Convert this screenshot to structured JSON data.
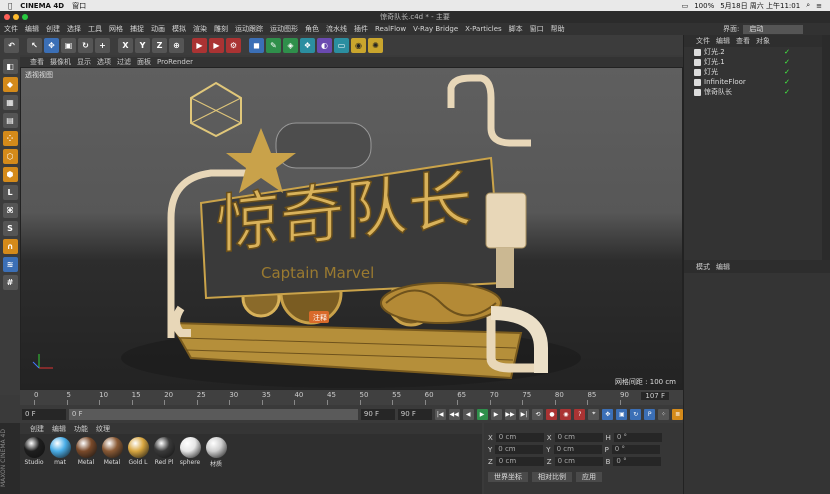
{
  "mac": {
    "app": "CINEMA 4D",
    "menu": "窗口",
    "battery": "100%",
    "datetime": "5月18日 周六 上午11:01"
  },
  "window": {
    "title": "惊奇队长.c4d * - 主要"
  },
  "menubar": [
    "文件",
    "编辑",
    "创建",
    "选择",
    "工具",
    "网格",
    "捕捉",
    "动画",
    "模拟",
    "渲染",
    "雕刻",
    "运动跟踪",
    "运动图形",
    "角色",
    "流水线",
    "插件",
    "RealFlow",
    "V-Ray Bridge",
    "X-Particles",
    "脚本",
    "窗口",
    "帮助"
  ],
  "layout": {
    "label": "界面:",
    "value": "启动"
  },
  "toolbar": {
    "axis_labels": [
      "X",
      "Y",
      "Z"
    ]
  },
  "viewport": {
    "menu": [
      "查看",
      "摄像机",
      "显示",
      "选项",
      "过滤",
      "面板",
      "ProRender"
    ],
    "label": "透视视图",
    "grid": "网格间距 : 100 cm",
    "annotation": "注释",
    "scene_text": "Captain Marvel"
  },
  "timeline": {
    "ticks": [
      "0",
      "5",
      "10",
      "15",
      "20",
      "25",
      "30",
      "35",
      "40",
      "45",
      "50",
      "55",
      "60",
      "65",
      "70",
      "75",
      "80",
      "85",
      "90"
    ],
    "end_badge": "107 F"
  },
  "frames": {
    "start": "0 F",
    "current": "0 F",
    "end": "90 F",
    "max": "90 F"
  },
  "materials": {
    "menu": [
      "创建",
      "编辑",
      "功能",
      "纹理"
    ],
    "items": [
      {
        "name": "Studio",
        "color": "#1e1e1e"
      },
      {
        "name": "mat",
        "color": "#4aaee8"
      },
      {
        "name": "Metal",
        "color": "#7a4a2a"
      },
      {
        "name": "Metal",
        "color": "#8a5a35"
      },
      {
        "name": "Gold L",
        "color": "#d8a640"
      },
      {
        "name": "Red Pl",
        "color": "#3a3a3a"
      },
      {
        "name": "sphere",
        "color": "#e6e6e6"
      },
      {
        "name": "材质",
        "color": "#cfcfcf"
      }
    ],
    "brand": "MAXON CINEMA 4D"
  },
  "coords": {
    "rows": [
      {
        "a": "X",
        "v1": "0 cm",
        "b": "X",
        "v2": "0 cm",
        "c": "H",
        "v3": "0 °"
      },
      {
        "a": "Y",
        "v1": "0 cm",
        "b": "Y",
        "v2": "0 cm",
        "c": "P",
        "v3": "0 °"
      },
      {
        "a": "Z",
        "v1": "0 cm",
        "b": "Z",
        "v2": "0 cm",
        "c": "B",
        "v3": "0 °"
      }
    ],
    "world": "世界坐标",
    "scale": "相对比例",
    "apply": "应用"
  },
  "objects": {
    "menu": [
      "文件",
      "编辑",
      "查看",
      "对象"
    ],
    "items": [
      "灯光.2",
      "灯光.1",
      "灯光",
      "InfiniteFloor",
      "惊奇队长"
    ]
  },
  "attributes": {
    "menu": [
      "模式",
      "编辑"
    ]
  },
  "colors": {
    "accent_gold": "#c9a24a",
    "select_blue": "#3b6fb6"
  }
}
